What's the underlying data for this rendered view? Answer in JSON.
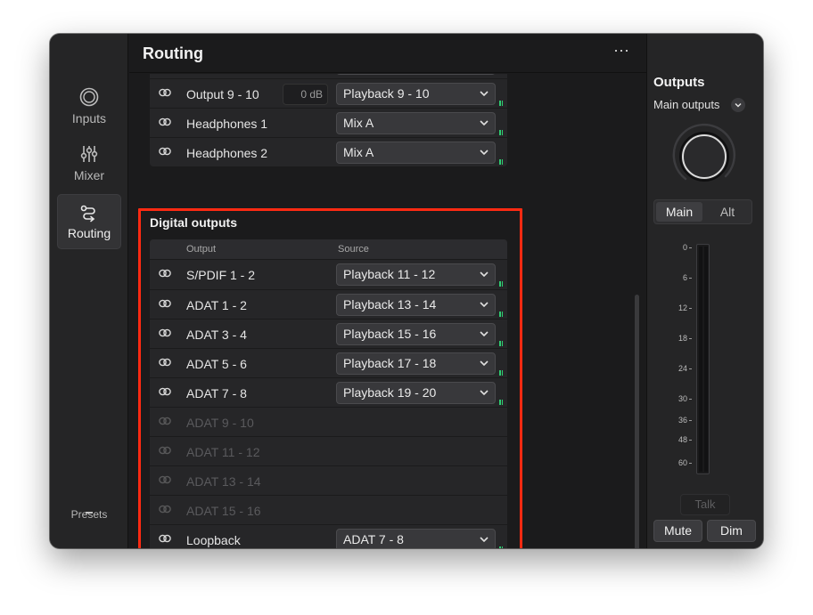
{
  "app": {
    "title": "Routing",
    "more_glyph": "⋯"
  },
  "sidebar": {
    "items": [
      {
        "label": "Inputs",
        "icon": "input-circle-icon"
      },
      {
        "label": "Mixer",
        "icon": "mixer-sliders-icon"
      },
      {
        "label": "Routing",
        "icon": "routing-icon",
        "active": true
      }
    ],
    "presets": "Presets"
  },
  "analogue_outputs": {
    "rows": [
      {
        "name": "Output 9 - 10",
        "gain": "0 dB",
        "source": "Playback 9 - 10"
      },
      {
        "name": "Headphones 1",
        "source": "Mix A"
      },
      {
        "name": "Headphones 2",
        "source": "Mix A"
      }
    ]
  },
  "digital_outputs": {
    "title": "Digital outputs",
    "col_output": "Output",
    "col_source": "Source",
    "rows": [
      {
        "name": "S/PDIF 1 - 2",
        "source": "Playback 11 - 12"
      },
      {
        "name": "ADAT 1 - 2",
        "source": "Playback 13 - 14"
      },
      {
        "name": "ADAT 3 - 4",
        "source": "Playback 15 - 16"
      },
      {
        "name": "ADAT 5 - 6",
        "source": "Playback 17 - 18"
      },
      {
        "name": "ADAT 7 - 8",
        "source": "Playback 19 - 20"
      },
      {
        "name": "ADAT 9 - 10",
        "disabled": true
      },
      {
        "name": "ADAT 11 - 12",
        "disabled": true
      },
      {
        "name": "ADAT 13 - 14",
        "disabled": true
      },
      {
        "name": "ADAT 15 - 16",
        "disabled": true
      },
      {
        "name": "Loopback",
        "source": "ADAT 7 - 8"
      }
    ]
  },
  "outputs_panel": {
    "title": "Outputs",
    "selector": "Main outputs",
    "seg_main": "Main",
    "seg_alt": "Alt",
    "scale": [
      "0",
      "6",
      "12",
      "18",
      "24",
      "30",
      "36",
      "48",
      "60"
    ],
    "talk": "Talk",
    "mute": "Mute",
    "dim": "Dim"
  },
  "colors": {
    "highlight": "#ff2a12",
    "meter_green": "#2ecc71",
    "background": "#1b1b1c"
  }
}
